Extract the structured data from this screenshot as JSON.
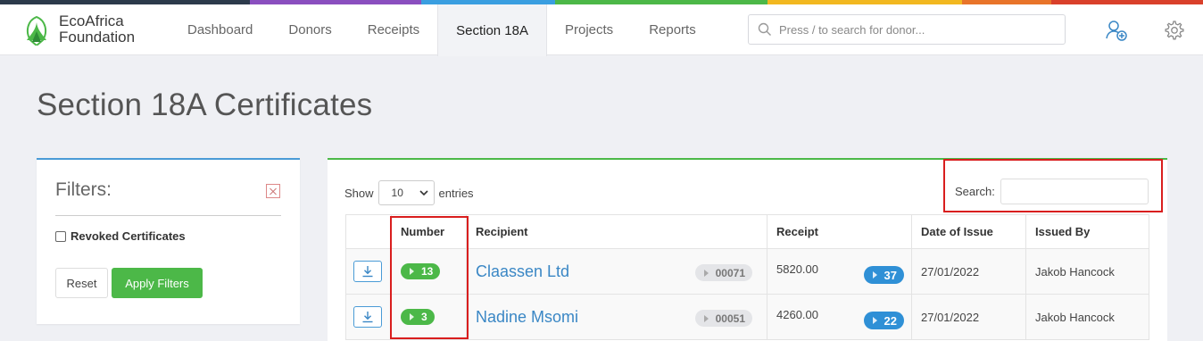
{
  "colors": {
    "stripe": [
      "#2c3a4b",
      "#8a4fbf",
      "#3a9ee0",
      "#4cb848",
      "#f2b820",
      "#e8742a",
      "#d9402b"
    ],
    "accent_green": "#4cb848",
    "accent_blue": "#2f90d6",
    "highlight_red": "#d91e1e"
  },
  "brand": {
    "line1": "EcoAfrica",
    "line2": "Foundation",
    "logo_icon": "leaf-logo-icon"
  },
  "nav": {
    "tabs": [
      {
        "label": "Dashboard",
        "active": false
      },
      {
        "label": "Donors",
        "active": false
      },
      {
        "label": "Receipts",
        "active": false
      },
      {
        "label": "Section 18A",
        "active": true
      },
      {
        "label": "Projects",
        "active": false
      },
      {
        "label": "Reports",
        "active": false
      }
    ],
    "search_placeholder": "Press / to search for donor...",
    "icons": [
      "search-icon",
      "add-user-icon",
      "gear-icon"
    ]
  },
  "page": {
    "title": "Section 18A Certificates"
  },
  "filters": {
    "title": "Filters:",
    "revoked_label": "Revoked Certificates",
    "revoked_checked": false,
    "reset_label": "Reset",
    "apply_label": "Apply Filters"
  },
  "table": {
    "show_label": "Show",
    "entries_value": "10",
    "entries_label": "entries",
    "search_label": "Search:",
    "search_value": "",
    "headers": [
      "",
      "Number",
      "Recipient",
      "Receipt",
      "Date of Issue",
      "Issued By"
    ],
    "rows": [
      {
        "number": "13",
        "recipient": "Claassen Ltd",
        "ref": "00071",
        "amount": "5820.00",
        "receipt": "37",
        "date": "27/01/2022",
        "issued_by": "Jakob Hancock"
      },
      {
        "number": "3",
        "recipient": "Nadine Msomi",
        "ref": "00051",
        "amount": "4260.00",
        "receipt": "22",
        "date": "27/01/2022",
        "issued_by": "Jakob Hancock"
      }
    ]
  }
}
